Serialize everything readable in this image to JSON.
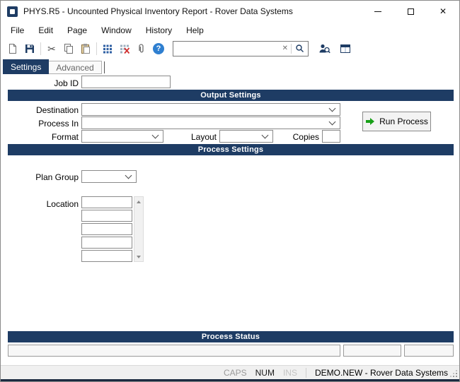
{
  "window": {
    "title": "PHYS.R5 - Uncounted Physical Inventory Report - Rover Data Systems",
    "close_glyph": "✕"
  },
  "menu": {
    "items": [
      {
        "label": "File"
      },
      {
        "label": "Edit"
      },
      {
        "label": "Page"
      },
      {
        "label": "Window"
      },
      {
        "label": "History"
      },
      {
        "label": "Help"
      }
    ]
  },
  "toolbar": {
    "icon_names": [
      "new-document-icon",
      "save-icon",
      "cut-icon",
      "copy-icon",
      "paste-icon",
      "grid-records-icon",
      "grid-delete-icon",
      "attachment-icon",
      "help-icon",
      "search-clear-icon",
      "search-magnifier-icon",
      "user-search-icon",
      "window-layout-icon"
    ],
    "cut_glyph": "✂",
    "help_glyph": "?",
    "search": {
      "value": "",
      "placeholder": "",
      "clear_glyph": "✕"
    }
  },
  "tabs": {
    "settings": {
      "label": "Settings",
      "active": true
    },
    "advanced": {
      "label": "Advanced",
      "active": false
    }
  },
  "form": {
    "job_id": {
      "label": "Job ID",
      "value": ""
    },
    "sections": {
      "output": "Output Settings",
      "process": "Process Settings",
      "status": "Process Status"
    },
    "destination": {
      "label": "Destination",
      "value": ""
    },
    "process_in": {
      "label": "Process In",
      "value": ""
    },
    "format": {
      "label": "Format",
      "value": ""
    },
    "layout": {
      "label": "Layout",
      "value": ""
    },
    "copies": {
      "label": "Copies",
      "value": ""
    },
    "run_button_label": "Run Process",
    "plan_group": {
      "label": "Plan Group",
      "value": ""
    },
    "location": {
      "label": "Location",
      "values": [
        "",
        "",
        "",
        "",
        ""
      ]
    },
    "status_fields": [
      "",
      "",
      ""
    ]
  },
  "statusbar": {
    "caps": "CAPS",
    "num": "NUM",
    "ins": "INS",
    "session": "DEMO.NEW - Rover Data Systems"
  },
  "colors": {
    "header_navy": "#1e3c64",
    "run_arrow_green": "#18a018",
    "help_blue": "#2f7fd0",
    "bottom_strip_navy": "#1b2a40"
  }
}
